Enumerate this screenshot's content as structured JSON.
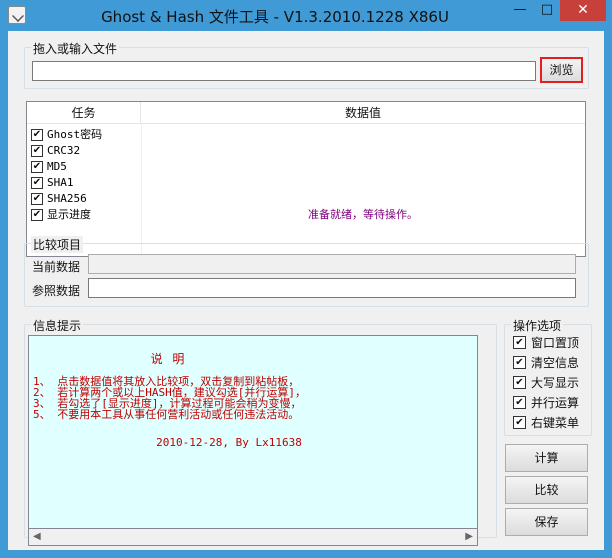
{
  "window": {
    "title": "Ghost & Hash 文件工具 - V1.3.2010.1228 X86U",
    "minimize": "—",
    "maximize": "□",
    "close": "✕"
  },
  "file": {
    "group_label": "拖入或输入文件",
    "value": "",
    "browse_label": "浏览"
  },
  "table": {
    "headers": [
      "任务",
      "数据值"
    ],
    "rows": [
      {
        "name": "Ghost密码",
        "checked": "✔",
        "value": ""
      },
      {
        "name": "CRC32",
        "checked": "✔",
        "value": ""
      },
      {
        "name": "MD5",
        "checked": "✔",
        "value": ""
      },
      {
        "name": "SHA1",
        "checked": "✔",
        "value": ""
      },
      {
        "name": "SHA256",
        "checked": "✔",
        "value": ""
      },
      {
        "name": "显示进度",
        "checked": "✔",
        "value": "准备就绪，等待操作。"
      }
    ]
  },
  "compare": {
    "group_label": "比较项目",
    "current_label": "当前数据",
    "reference_label": "参照数据",
    "current_value": "",
    "reference_value": ""
  },
  "info": {
    "group_label": "信息提示",
    "title": "说 明",
    "lines": [
      "1、 点击数据值将其放入比较项，双击复制到粘帖板，",
      "2、 若计算两个或以上HASH值，建议勾选[并行运算]，",
      "3、 若勾选了[显示进度]，计算过程可能会稍为变慢，",
      "5、 不要用本工具从事任何营利活动或任何违法活动。"
    ],
    "date": "2010-12-28, By Lx11638"
  },
  "options": {
    "group_label": "操作选项",
    "items": [
      {
        "label": "窗口置顶",
        "checked": "✔"
      },
      {
        "label": "清空信息",
        "checked": "✔"
      },
      {
        "label": "大写显示",
        "checked": "✔"
      },
      {
        "label": "并行运算",
        "checked": "✔"
      },
      {
        "label": "右键菜单",
        "checked": "✔"
      }
    ]
  },
  "actions": {
    "calculate": "计算",
    "compare": "比较",
    "save": "保存"
  },
  "colors": {
    "frame": "#3f9ad6",
    "close_button": "#c7403a",
    "info_background": "#e0ffff",
    "info_text": "#c00000",
    "status_text": "#800080",
    "browse_border": "#e02020"
  }
}
